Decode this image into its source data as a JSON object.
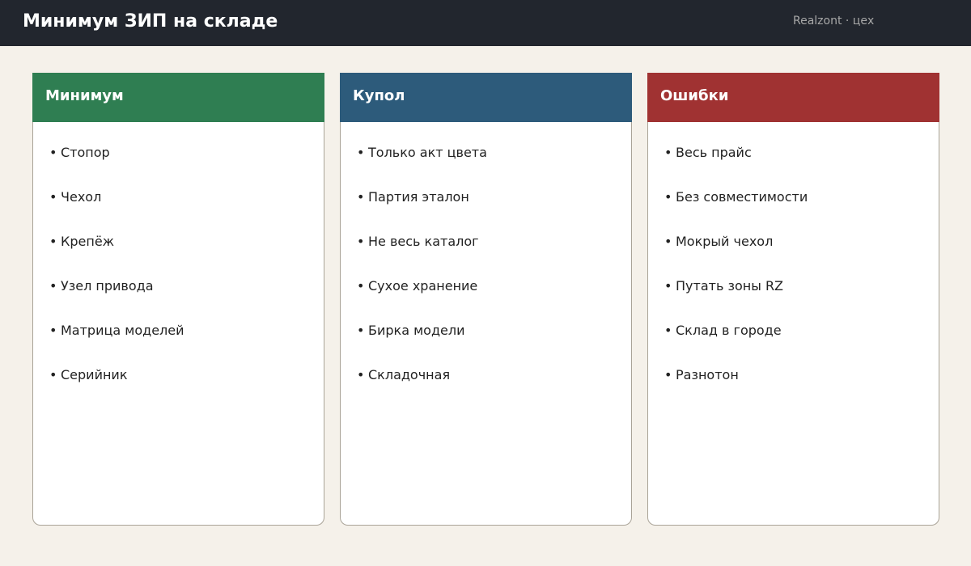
{
  "header": {
    "title": "Минимум ЗИП на складе",
    "subtitle": "Realzont · цех"
  },
  "columns": [
    {
      "title": "Минимум",
      "color": "#2f7e52",
      "items": [
        "Стопор",
        "Чехол",
        "Крепёж",
        "Узел привода",
        "Матрица моделей",
        "Серийник"
      ]
    },
    {
      "title": "Купол",
      "color": "#2d5b7b",
      "items": [
        "Только акт цвета",
        "Партия эталон",
        "Не весь каталог",
        "Сухое хранение",
        "Бирка модели",
        "Складочная"
      ]
    },
    {
      "title": "Ошибки",
      "color": "#a03232",
      "items": [
        "Весь прайс",
        "Без совместимости",
        "Мокрый чехол",
        "Путать зоны RZ",
        "Склад в городе",
        "Разнотон"
      ]
    }
  ],
  "bullet": "•"
}
